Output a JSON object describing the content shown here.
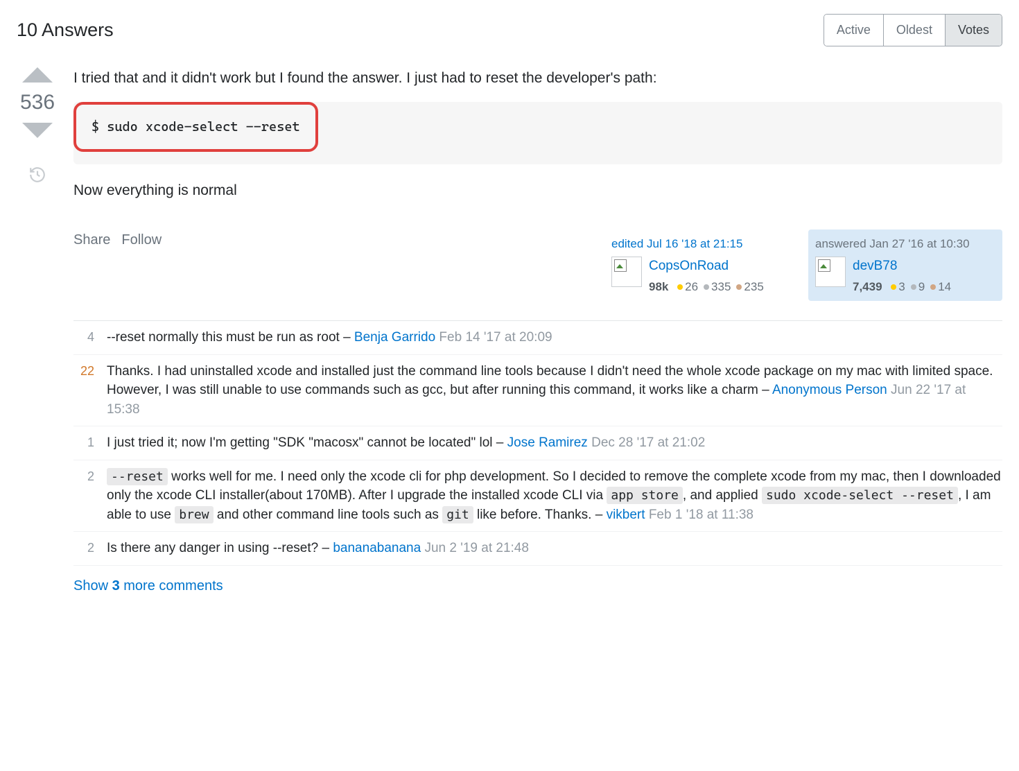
{
  "header": {
    "title": "10 Answers",
    "sort_tabs": [
      "Active",
      "Oldest",
      "Votes"
    ],
    "active_sort": "Votes"
  },
  "answer": {
    "vote_count": "536",
    "body_intro": "I tried that and it didn't work but I found the answer. I just had to reset the developer's path:",
    "code": "$ sudo xcode-select --reset",
    "body_outro": "Now everything is normal",
    "actions": {
      "share": "Share",
      "follow": "Follow"
    },
    "editor": {
      "action": "edited Jul 16 '18 at 21:15",
      "name": "CopsOnRoad",
      "rep": "98k",
      "gold": "26",
      "silver": "335",
      "bronze": "235"
    },
    "author": {
      "action": "answered Jan 27 '16 at 10:30",
      "name": "devB78",
      "rep": "7,439",
      "gold": "3",
      "silver": "9",
      "bronze": "14"
    }
  },
  "comments": [
    {
      "score": "4",
      "hot": false,
      "parts": [
        {
          "t": "text",
          "v": "--reset normally this must be run as root – "
        },
        {
          "t": "user",
          "v": "Benja Garrido"
        },
        {
          "t": "date",
          "v": " Feb 14 '17 at 20:09"
        }
      ]
    },
    {
      "score": "22",
      "hot": true,
      "parts": [
        {
          "t": "text",
          "v": "Thanks. I had uninstalled xcode and installed just the command line tools because I didn't need the whole xcode package on my mac with limited space. However, I was still unable to use commands such as gcc, but after running this command, it works like a charm – "
        },
        {
          "t": "user",
          "v": "Anonymous Person"
        },
        {
          "t": "date",
          "v": " Jun 22 '17 at 15:38"
        }
      ]
    },
    {
      "score": "1",
      "hot": false,
      "parts": [
        {
          "t": "text",
          "v": "I just tried it; now I'm getting \"SDK \"macosx\" cannot be located\" lol – "
        },
        {
          "t": "user",
          "v": "Jose Ramirez"
        },
        {
          "t": "date",
          "v": " Dec 28 '17 at 21:02"
        }
      ]
    },
    {
      "score": "2",
      "hot": false,
      "parts": [
        {
          "t": "code",
          "v": "--reset"
        },
        {
          "t": "text",
          "v": " works well for me. I need only the xcode cli for php development. So I decided to remove the complete xcode from my mac, then I downloaded only the xcode CLI installer(about 170MB). After I upgrade the installed xcode CLI via "
        },
        {
          "t": "code",
          "v": "app store"
        },
        {
          "t": "text",
          "v": ", and applied "
        },
        {
          "t": "code",
          "v": "sudo xcode-select --reset"
        },
        {
          "t": "text",
          "v": ", I am able to use "
        },
        {
          "t": "code",
          "v": "brew"
        },
        {
          "t": "text",
          "v": " and other command line tools such as "
        },
        {
          "t": "code",
          "v": "git"
        },
        {
          "t": "text",
          "v": " like before. Thanks. – "
        },
        {
          "t": "user",
          "v": "vikbert"
        },
        {
          "t": "date",
          "v": " Feb 1 '18 at 11:38"
        }
      ]
    },
    {
      "score": "2",
      "hot": false,
      "parts": [
        {
          "t": "text",
          "v": "Is there any danger in using --reset? – "
        },
        {
          "t": "user",
          "v": "bananabanana"
        },
        {
          "t": "date",
          "v": " Jun 2 '19 at 21:48"
        }
      ]
    }
  ],
  "show_more": {
    "prefix": "Show ",
    "count": "3",
    "suffix": " more comments"
  }
}
